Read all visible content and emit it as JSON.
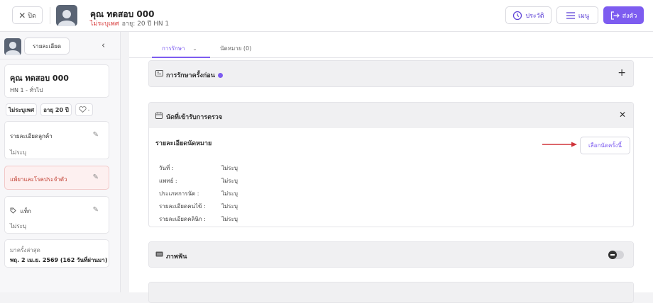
{
  "header": {
    "close_label": "ปิด",
    "patient_name": "คุณ ทดสอบ 000",
    "gender_status": "ไม่ระบุเพศ",
    "age_hn": "อายุ: 20 ปี  HN 1",
    "history_label": "ประวัติ",
    "menu_label": "เมนู",
    "send_label": "ส่งตัว"
  },
  "sidebar": {
    "detail_button": "รายละเอียด",
    "name": "คุณ ทดสอบ 000",
    "hn_type": "HN 1 - ทั่วไป",
    "chips": {
      "gender": "ไม่ระบุเพศ",
      "age": "อายุ 20 ปี"
    },
    "customer_detail": {
      "title": "รายละเอียดลูกค้า",
      "value": "ไม่ระบุ"
    },
    "allergy": {
      "title": "แพ้ยาและโรคประจำตัว"
    },
    "tag": {
      "title": "แท็ก",
      "value": "ไม่ระบุ"
    },
    "last_visit": {
      "title": "มาครั้งล่าสุด",
      "value": "พฤ. 2 เม.ย. 2569 (162 วันที่ผ่านมา)"
    }
  },
  "tabs": [
    {
      "label": "การรักษา"
    },
    {
      "label": "นัดหมาย (0)"
    }
  ],
  "panels": {
    "previous_treatment": {
      "title": "การรักษาครั้งก่อน"
    },
    "appointment": {
      "title": "นัดที่เข้ารับการตรวจ",
      "detail_title": "รายละเอียดนัดหมาย",
      "choose_button": "เลือกนัดครั้งนี้",
      "rows": [
        {
          "label": "วันที่ :",
          "value": "ไม่ระบุ"
        },
        {
          "label": "แพทย์ :",
          "value": "ไม่ระบุ"
        },
        {
          "label": "ประเภทการนัด :",
          "value": "ไม่ระบุ"
        },
        {
          "label": "รายละเอียดคนไข้ :",
          "value": "ไม่ระบุ"
        },
        {
          "label": "รายละเอียดคลินิก :",
          "value": "ไม่ระบุ"
        }
      ]
    },
    "photos": {
      "title": "ภาพฟัน"
    }
  },
  "colors": {
    "accent": "#7d5cf0",
    "danger": "#d73a3a",
    "arrow": "#d0343a"
  }
}
